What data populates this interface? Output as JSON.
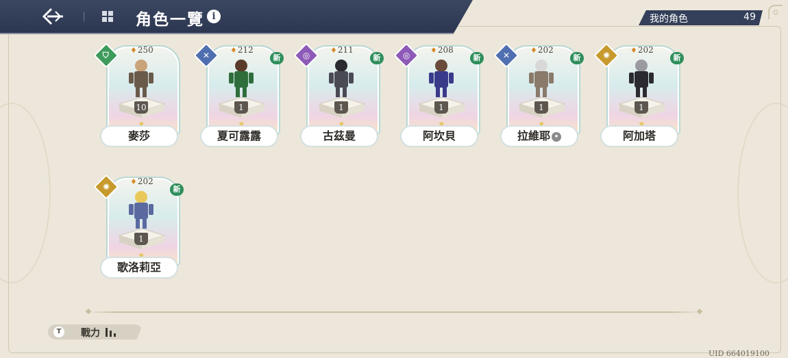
{
  "header": {
    "title": "角色一覽",
    "info_symbol": "i"
  },
  "counter": {
    "label": "我的角色",
    "count": "49"
  },
  "characters": [
    {
      "name": "麥莎",
      "power": "250",
      "level": "10",
      "element": "shield",
      "element_color": "#3f9b5c",
      "is_new": false,
      "new_label": ""
    },
    {
      "name": "夏可露露",
      "power": "212",
      "level": "1",
      "element": "crossed-swords",
      "element_color": "#4f6fb0",
      "is_new": true,
      "new_label": "新"
    },
    {
      "name": "古茲曼",
      "power": "211",
      "level": "1",
      "element": "vortex",
      "element_color": "#8e5ab8",
      "is_new": true,
      "new_label": "新"
    },
    {
      "name": "阿坎貝",
      "power": "208",
      "level": "1",
      "element": "vortex",
      "element_color": "#8e5ab8",
      "is_new": true,
      "new_label": "新"
    },
    {
      "name": "拉維耶",
      "power": "202",
      "level": "1",
      "element": "crossed-swords",
      "element_color": "#4f6fb0",
      "is_new": true,
      "new_label": "新",
      "extra_badge": true
    },
    {
      "name": "阿加塔",
      "power": "202",
      "level": "1",
      "element": "sun",
      "element_color": "#c79a2e",
      "is_new": true,
      "new_label": "新"
    },
    {
      "name": "歌洛莉亞",
      "power": "202",
      "level": "1",
      "element": "sun",
      "element_color": "#c79a2e",
      "is_new": true,
      "new_label": "新"
    }
  ],
  "footer": {
    "sort_label": "戰力",
    "sort_icon_letter": "T",
    "uid": "UID 664019100"
  }
}
